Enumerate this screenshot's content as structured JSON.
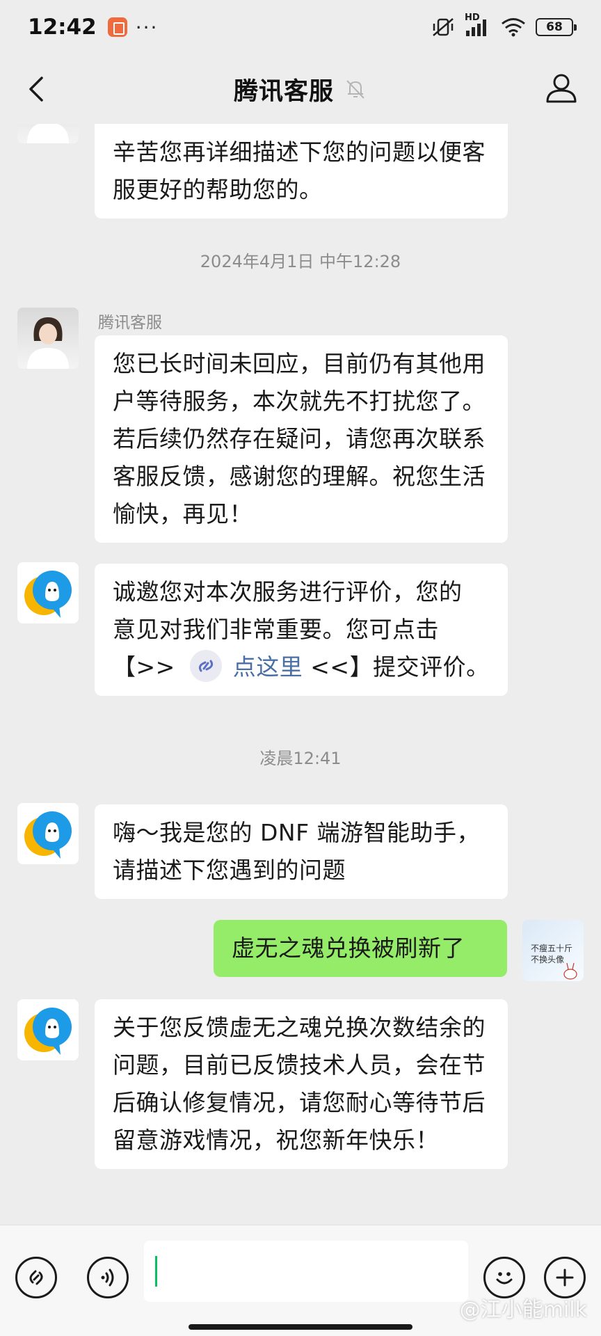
{
  "status_bar": {
    "time": "12:42",
    "dots": "···",
    "battery": "68",
    "network_label": "HD"
  },
  "header": {
    "title": "腾讯客服"
  },
  "messages": [
    {
      "text": "辛苦您再详细描述下您的问题以便客服更好的帮助您的。"
    },
    {
      "timestamp": "2024年4月1日 中午12:28"
    },
    {
      "sender": "腾讯客服",
      "text": "您已长时间未回应，目前仍有其他用户等待服务，本次就先不打扰您了。若后续仍然存在疑问，请您再次联系客服反馈，感谢您的理解。祝您生活愉快，再见！"
    },
    {
      "text_line1": "诚邀您对本次服务进行评价，您的",
      "text_line2": "意见对我们非常重要。您可点击",
      "text_prefix": "【>> ",
      "link": "点这里",
      "text_suffix": " <<】提交评价。"
    },
    {
      "timestamp": "凌晨12:41"
    },
    {
      "text": "嗨～我是您的 DNF 端游智能助手，请描述下您遇到的问题"
    },
    {
      "text": "虚无之魂兑换被刷新了",
      "avatar_text_1": "不瘦五十斤",
      "avatar_text_2": "不换头像"
    },
    {
      "text": "关于您反馈虚无之魂兑换次数结余的问题，目前已反馈技术人员，会在节后确认修复情况，请您耐心等待节后留意游戏情况，祝您新年快乐！"
    }
  ],
  "input": {
    "value": "",
    "watermark": "@江小能milk"
  },
  "colors": {
    "background": "#ededed",
    "bubble_received": "#ffffff",
    "bubble_sent": "#95ec69",
    "link": "#4a6fa5",
    "caret": "#07c160"
  }
}
